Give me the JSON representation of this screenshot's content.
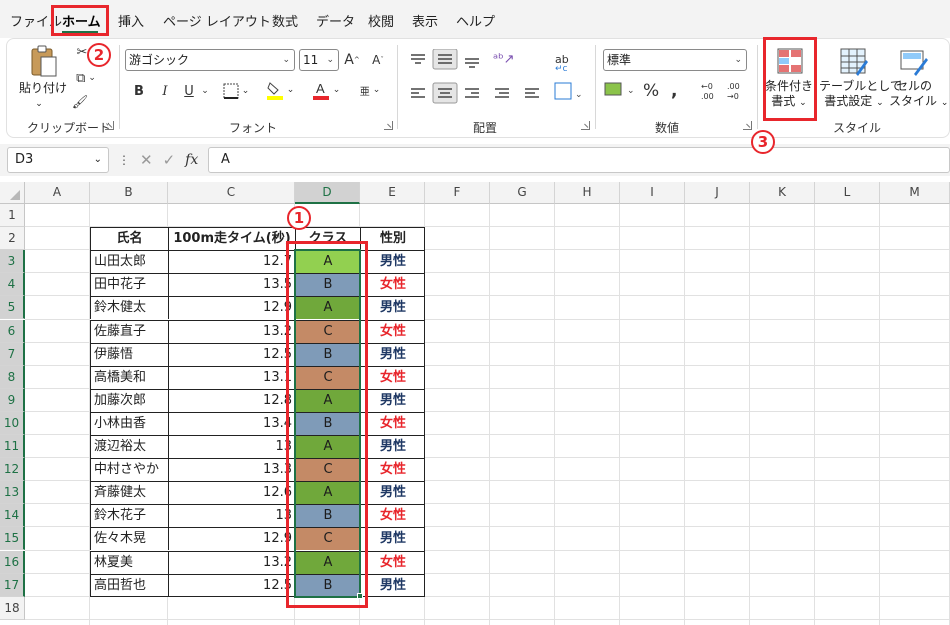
{
  "menu": {
    "tabs": [
      "ファイル",
      "ホーム",
      "挿入",
      "ページ レイアウト",
      "数式",
      "データ",
      "校閲",
      "表示",
      "ヘルプ"
    ],
    "active_tab": "ホーム"
  },
  "ribbon": {
    "clipboard": {
      "paste_label": "貼り付け",
      "group_label": "クリップボード"
    },
    "font": {
      "font_name": "游ゴシック",
      "font_size": "11",
      "bold": "B",
      "italic": "I",
      "underline": "U",
      "group_label": "フォント"
    },
    "alignment": {
      "group_label": "配置"
    },
    "number": {
      "format": "標準",
      "group_label": "数値"
    },
    "styles": {
      "conditional_format_line1": "条件付き",
      "conditional_format_line2": "書式",
      "table_format_line1": "テーブルとして",
      "table_format_line2": "書式設定",
      "cell_style_line1": "セルの",
      "cell_style_line2": "スタイル",
      "group_label": "スタイル"
    }
  },
  "formula_bar": {
    "name_box": "D3",
    "fx": "fx",
    "content": "A"
  },
  "sheet": {
    "columns": [
      "A",
      "B",
      "C",
      "D",
      "E",
      "F",
      "G",
      "H",
      "I",
      "J",
      "K",
      "L",
      "M"
    ],
    "selected_column": "D",
    "rows": [
      "1",
      "2",
      "3",
      "4",
      "5",
      "6",
      "7",
      "8",
      "9",
      "10",
      "11",
      "12",
      "13",
      "14",
      "15",
      "16",
      "17",
      "18"
    ],
    "table_headers": [
      "氏名",
      "100m走タイム(秒)",
      "クラス",
      "性別"
    ],
    "records": [
      {
        "name": "山田太郎",
        "time": "12.7",
        "class": "A",
        "gender": "男性"
      },
      {
        "name": "田中花子",
        "time": "13.5",
        "class": "B",
        "gender": "女性"
      },
      {
        "name": "鈴木健太",
        "time": "12.9",
        "class": "A",
        "gender": "男性"
      },
      {
        "name": "佐藤直子",
        "time": "13.2",
        "class": "C",
        "gender": "女性"
      },
      {
        "name": "伊藤悟",
        "time": "12.5",
        "class": "B",
        "gender": "男性"
      },
      {
        "name": "高橋美和",
        "time": "13.1",
        "class": "C",
        "gender": "女性"
      },
      {
        "name": "加藤次郎",
        "time": "12.8",
        "class": "A",
        "gender": "男性"
      },
      {
        "name": "小林由香",
        "time": "13.4",
        "class": "B",
        "gender": "女性"
      },
      {
        "name": "渡辺裕太",
        "time": "13",
        "class": "A",
        "gender": "男性"
      },
      {
        "name": "中村さやか",
        "time": "13.3",
        "class": "C",
        "gender": "女性"
      },
      {
        "name": "斉藤健太",
        "time": "12.6",
        "class": "A",
        "gender": "男性"
      },
      {
        "name": "鈴木花子",
        "time": "13",
        "class": "B",
        "gender": "女性"
      },
      {
        "name": "佐々木晃",
        "time": "12.9",
        "class": "C",
        "gender": "男性"
      },
      {
        "name": "林夏美",
        "time": "13.2",
        "class": "A",
        "gender": "女性"
      },
      {
        "name": "高田哲也",
        "time": "12.5",
        "class": "B",
        "gender": "男性"
      }
    ],
    "class_colors": {
      "A": "#70a83b",
      "B": "#7f9bb8",
      "C": "#c48a66",
      "A_first": "#92d050"
    },
    "gender_colors": {
      "男性": "#1f3864",
      "女性": "#e8262c"
    }
  },
  "annotations": {
    "badge1": "1",
    "badge2": "2",
    "badge3": "3",
    "color": "#e8262c"
  }
}
